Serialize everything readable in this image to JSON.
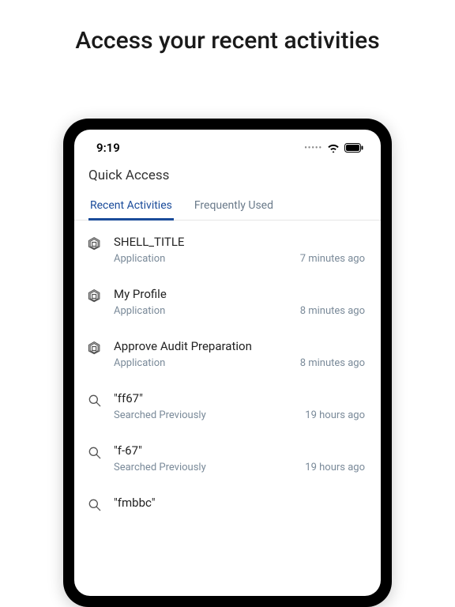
{
  "headline": "Access your recent activities",
  "statusbar": {
    "time": "9:19"
  },
  "page_title": "Quick Access",
  "tabs": [
    {
      "label": "Recent Activities",
      "active": true
    },
    {
      "label": "Frequently Used",
      "active": false
    }
  ],
  "items": [
    {
      "icon": "app",
      "title": "SHELL_TITLE",
      "subtitle": "Application",
      "time": "7 minutes ago"
    },
    {
      "icon": "app",
      "title": "My Profile",
      "subtitle": "Application",
      "time": "8 minutes ago"
    },
    {
      "icon": "app",
      "title": "Approve Audit Preparation",
      "subtitle": "Application",
      "time": "8 minutes ago"
    },
    {
      "icon": "search",
      "title": "\"ff67\"",
      "subtitle": "Searched Previously",
      "time": "19 hours ago"
    },
    {
      "icon": "search",
      "title": "\"f-67\"",
      "subtitle": "Searched Previously",
      "time": "19 hours ago"
    },
    {
      "icon": "search",
      "title": "\"fmbbc\"",
      "subtitle": "",
      "time": ""
    }
  ]
}
